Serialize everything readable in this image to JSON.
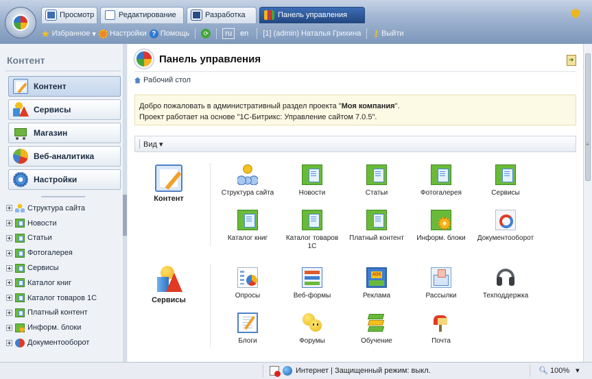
{
  "tabs": [
    {
      "label": "Просмотр",
      "active": false,
      "icon": "monitor-icon"
    },
    {
      "label": "Редактирование",
      "active": false,
      "icon": "pencil-icon"
    },
    {
      "label": "Разработка",
      "active": false,
      "icon": "code-icon"
    },
    {
      "label": "Панель управления",
      "active": true,
      "icon": "control-panel-icon"
    }
  ],
  "toolbar": {
    "favorites": "Избранное",
    "settings": "Настройки",
    "help": "Помощь",
    "lang_ru": "ru",
    "lang_en": "en",
    "user": "[1] (admin) Наталья Грихина",
    "logout": "Выйти"
  },
  "sidebar": {
    "title": "Контент",
    "menu": [
      {
        "label": "Контент",
        "icon": "content-pencil-icon",
        "active": true
      },
      {
        "label": "Сервисы",
        "icon": "services-shapes-icon",
        "active": false
      },
      {
        "label": "Магазин",
        "icon": "cart-icon",
        "active": false
      },
      {
        "label": "Веб-аналитика",
        "icon": "analytics-pie-icon",
        "active": false
      },
      {
        "label": "Настройки",
        "icon": "settings-gear-icon",
        "active": false
      }
    ],
    "tree": [
      {
        "label": "Структура сайта",
        "icon": "structure-icon"
      },
      {
        "label": "Новости",
        "icon": "iblock-icon"
      },
      {
        "label": "Статьи",
        "icon": "iblock-icon"
      },
      {
        "label": "Фотогалерея",
        "icon": "iblock-icon"
      },
      {
        "label": "Сервисы",
        "icon": "iblock-icon"
      },
      {
        "label": "Каталог книг",
        "icon": "iblock-icon"
      },
      {
        "label": "Каталог товаров 1С",
        "icon": "iblock-icon"
      },
      {
        "label": "Платный контент",
        "icon": "iblock-icon"
      },
      {
        "label": "Информ. блоки",
        "icon": "iblock-gear-icon"
      },
      {
        "label": "Документооборот",
        "icon": "workflow-icon"
      }
    ]
  },
  "main": {
    "title": "Панель управления",
    "breadcrumb": "Рабочий стол",
    "welcome_prefix": "Добро пожаловать в административный раздел проекта \"",
    "welcome_company": "Моя компания",
    "welcome_suffix": "\".",
    "welcome_line2": "Проект работает на основе \"1С-Битрикс: Управление сайтом 7.0.5\".",
    "view_label": "Вид",
    "groups": [
      {
        "label": "Контент",
        "tiles": [
          {
            "label": "Структура сайта",
            "icon": "structure-icon"
          },
          {
            "label": "Новости",
            "icon": "iblock-icon"
          },
          {
            "label": "Статьи",
            "icon": "iblock-icon"
          },
          {
            "label": "Фотогалерея",
            "icon": "iblock-icon"
          },
          {
            "label": "Сервисы",
            "icon": "iblock-icon"
          },
          {
            "label": "Каталог книг",
            "icon": "iblock-icon"
          },
          {
            "label": "Каталог товаров 1С",
            "icon": "iblock-icon"
          },
          {
            "label": "Платный контент",
            "icon": "iblock-icon"
          },
          {
            "label": "Информ. блоки",
            "icon": "iblock-gear-icon"
          },
          {
            "label": "Документооборот",
            "icon": "workflow-icon"
          }
        ]
      },
      {
        "label": "Сервисы",
        "tiles": [
          {
            "label": "Опросы",
            "icon": "poll-icon"
          },
          {
            "label": "Веб-формы",
            "icon": "webform-icon"
          },
          {
            "label": "Реклама",
            "icon": "ads-icon"
          },
          {
            "label": "Рассылки",
            "icon": "mailing-icon"
          },
          {
            "label": "Техподдержка",
            "icon": "headset-icon"
          },
          {
            "label": "Блоги",
            "icon": "blog-icon"
          },
          {
            "label": "Форумы",
            "icon": "forum-smiley-icon"
          },
          {
            "label": "Обучение",
            "icon": "learning-book-icon"
          },
          {
            "label": "Почта",
            "icon": "mailbox-icon"
          }
        ]
      }
    ]
  },
  "statusbar": {
    "zone": "Интернет | Защищенный режим: выкл.",
    "zoom": "100%"
  },
  "colors": {
    "accent_tab": "#2b5798",
    "welcome_bg": "#fcf9e4",
    "iblock_green": "#6aba3a"
  }
}
